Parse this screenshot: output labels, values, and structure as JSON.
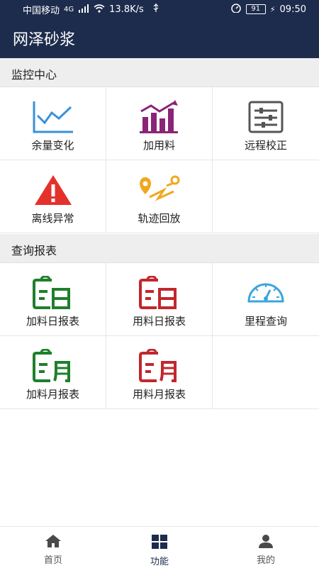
{
  "status": {
    "carrier": "中国移动",
    "network": "4G",
    "speed": "13.8K/s",
    "battery": "91",
    "time": "09:50"
  },
  "app": {
    "title": "网泽砂浆"
  },
  "sections": [
    {
      "title": "监控中心",
      "items": [
        {
          "label": "余量变化",
          "icon": "line-chart-icon",
          "color": "#3a91d9"
        },
        {
          "label": "加用料",
          "icon": "bar-trend-icon",
          "color": "#8b2377"
        },
        {
          "label": "远程校正",
          "icon": "sliders-icon",
          "color": "#555555"
        },
        {
          "label": "离线异常",
          "icon": "warning-icon",
          "color": "#e5312b"
        },
        {
          "label": "轨迹回放",
          "icon": "route-pin-icon",
          "color": "#f0a81e"
        }
      ]
    },
    {
      "title": "查询报表",
      "items": [
        {
          "label": "加料日报表",
          "icon": "daily-report-icon",
          "color": "#1f7f2c"
        },
        {
          "label": "用料日报表",
          "icon": "daily-report-icon",
          "color": "#c1272d"
        },
        {
          "label": "里程查询",
          "icon": "speedometer-icon",
          "color": "#3ba5dc"
        },
        {
          "label": "加料月报表",
          "icon": "monthly-report-icon",
          "color": "#1f7f2c"
        },
        {
          "label": "用料月报表",
          "icon": "monthly-report-icon",
          "color": "#c1272d"
        }
      ]
    }
  ],
  "tabbar": {
    "items": [
      {
        "label": "首页",
        "icon": "home-icon"
      },
      {
        "label": "功能",
        "icon": "grid-icon",
        "active": true
      },
      {
        "label": "我的",
        "icon": "user-icon"
      }
    ]
  }
}
